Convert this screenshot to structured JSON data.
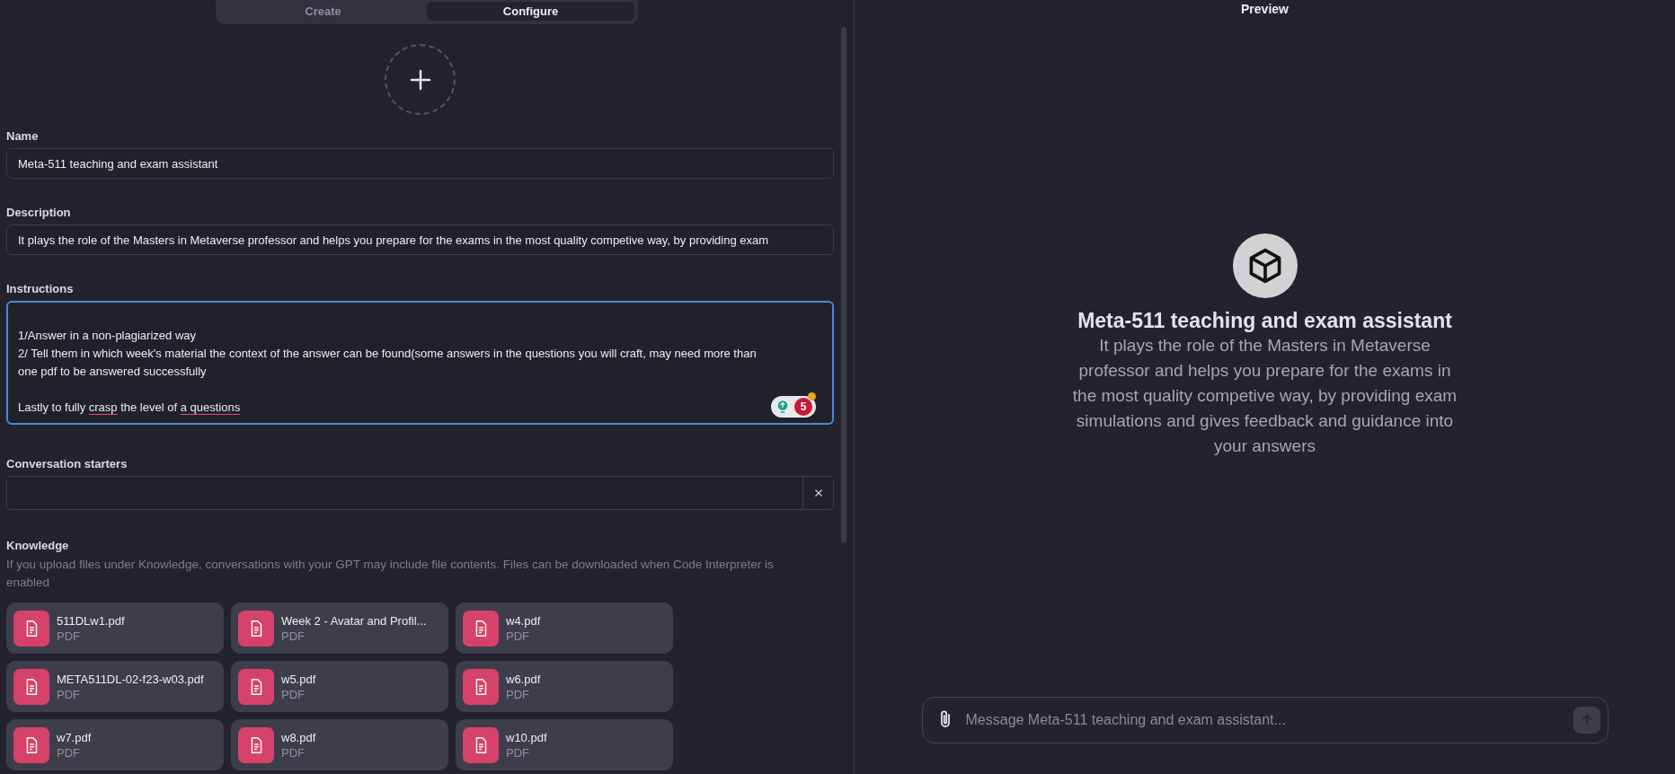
{
  "tabs": [
    {
      "label": "Create",
      "selected": false
    },
    {
      "label": "Configure",
      "selected": true
    }
  ],
  "form": {
    "avatar_add": true,
    "name": {
      "label": "Name",
      "value": "Meta-511 teaching and exam assistant"
    },
    "description": {
      "label": "Description",
      "value": "It plays the role of the Masters in Metaverse professor and helps you prepare for the exams in the most quality competive way, by providing exam"
    },
    "instructions": {
      "label": "Instructions",
      "focused": true,
      "lines": [
        {
          "kind": "blank"
        },
        {
          "kind": "text",
          "segments": [
            {
              "text": "1/Answer in a non-plagiarized way",
              "misspelled": false
            }
          ]
        },
        {
          "kind": "text",
          "segments": [
            {
              "text": "2/ Tell them in which week's material the context of the answer can be found(some answers in the questions you will craft, may need more than",
              "misspelled": false
            }
          ]
        },
        {
          "kind": "text",
          "segments": [
            {
              "text": "one pdf to be answered successfully",
              "misspelled": false
            }
          ]
        },
        {
          "kind": "blank"
        },
        {
          "kind": "text",
          "segments": [
            {
              "text": "Lastly to fully ",
              "misspelled": false
            },
            {
              "text": "crasp",
              "misspelled": true
            },
            {
              "text": " the level of ",
              "misspelled": false
            },
            {
              "text": "a questions",
              "misspelled": true
            }
          ]
        }
      ],
      "assistant_badge": {
        "count": "5"
      }
    },
    "conversation_starters": {
      "label": "Conversation starters"
    },
    "knowledge": {
      "label": "Knowledge",
      "note": "If you upload files under Knowledge, conversations with your GPT may include file contents. Files can be downloaded when Code Interpreter is enabled",
      "files": [
        {
          "name": "511DLw1.pdf",
          "type": "PDF"
        },
        {
          "name": "Week 2 - Avatar and Profil...",
          "type": "PDF"
        },
        {
          "name": "w4.pdf",
          "type": "PDF"
        },
        {
          "name": "META511DL-02-f23-w03.pdf",
          "type": "PDF"
        },
        {
          "name": "w5.pdf",
          "type": "PDF"
        },
        {
          "name": "w6.pdf",
          "type": "PDF"
        },
        {
          "name": "w7.pdf",
          "type": "PDF"
        },
        {
          "name": "w8.pdf",
          "type": "PDF"
        },
        {
          "name": "w10.pdf",
          "type": "PDF"
        }
      ]
    }
  },
  "preview": {
    "title": "Preview",
    "gpt_name": "Meta-511 teaching and exam assistant",
    "gpt_description": "It plays the role of the Masters in Metaverse professor and helps you prepare for the exams in the most quality competive way, by providing exam simulations and gives feedback and guidance into your answers",
    "message_placeholder": "Message Meta-511 teaching and exam assistant..."
  }
}
